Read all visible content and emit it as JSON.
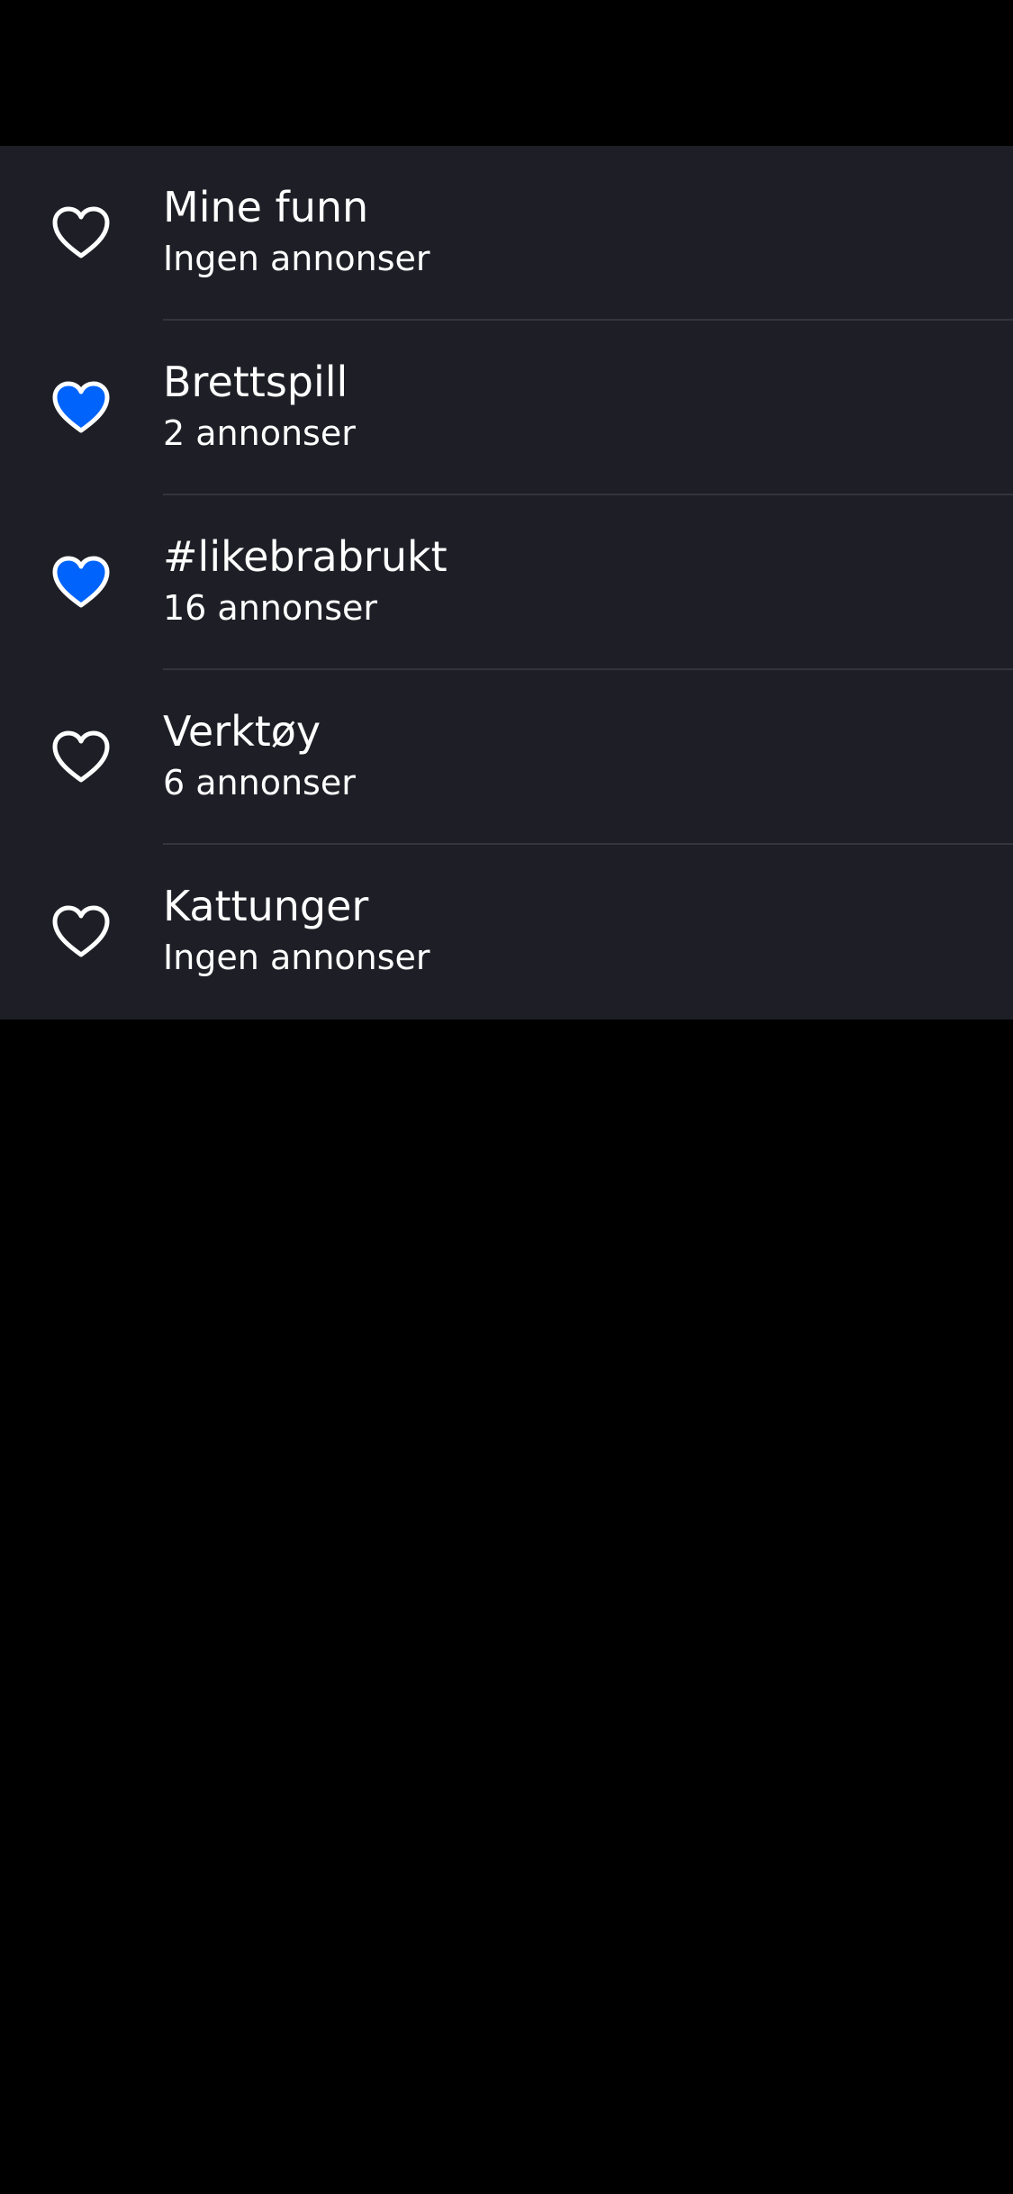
{
  "colors": {
    "background": "#000000",
    "list_background": "#1e1f26",
    "divider": "#34353c",
    "heart_active": "#0063fb",
    "text": "#ffffff"
  },
  "lists": [
    {
      "title": "Mine funn",
      "subtitle": "Ingen annonser",
      "icon": "heart-outline-icon",
      "favorited": false
    },
    {
      "title": "Brettspill",
      "subtitle": "2 annonser",
      "icon": "heart-filled-icon",
      "favorited": true
    },
    {
      "title": "#likebrabrukt",
      "subtitle": "16 annonser",
      "icon": "heart-filled-icon",
      "favorited": true
    },
    {
      "title": "Verktøy",
      "subtitle": "6 annonser",
      "icon": "heart-outline-icon",
      "favorited": false
    },
    {
      "title": "Kattunger",
      "subtitle": "Ingen annonser",
      "icon": "heart-outline-icon",
      "favorited": false
    }
  ]
}
